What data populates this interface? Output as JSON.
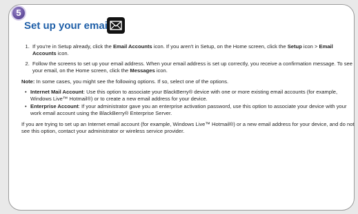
{
  "step_badge": "5",
  "title": "Set up your email",
  "steps": [
    {
      "pre": "If you're in Setup already, click the ",
      "b1": "Email Accounts",
      "mid": " icon. If you aren't in Setup, on the Home screen, click the ",
      "b2": "Setup",
      "sep": " icon > ",
      "b3": "Email Accounts",
      "post": " icon."
    },
    {
      "pre": "Follow the screens to set up your email address. When your email address is set up correctly, you receive a confirmation message. To see your email, on the Home screen, click the ",
      "b1": "Messages",
      "post": " icon."
    }
  ],
  "note": {
    "label": "Note:",
    "text": " In some cases, you might see the following options. If so, select one of the options."
  },
  "options": [
    {
      "name": "Internet Mail Account",
      "text": ": Use this option to associate your BlackBerry® device with one or more existing email accounts (for example, Windows Live™ Hotmail®) or to create a new email address for your device."
    },
    {
      "name": "Enterprise Account",
      "text": ": If your administrator gave you an enterprise activation password, use this option to associate your device with your work email account using the BlackBerry® Enterprise Server."
    }
  ],
  "final": "If you are trying to set up an Internet email account (for example, Windows Live™ Hotmail®) or a new email address for your device, and do not see this option, contact your administrator or wireless service provider."
}
